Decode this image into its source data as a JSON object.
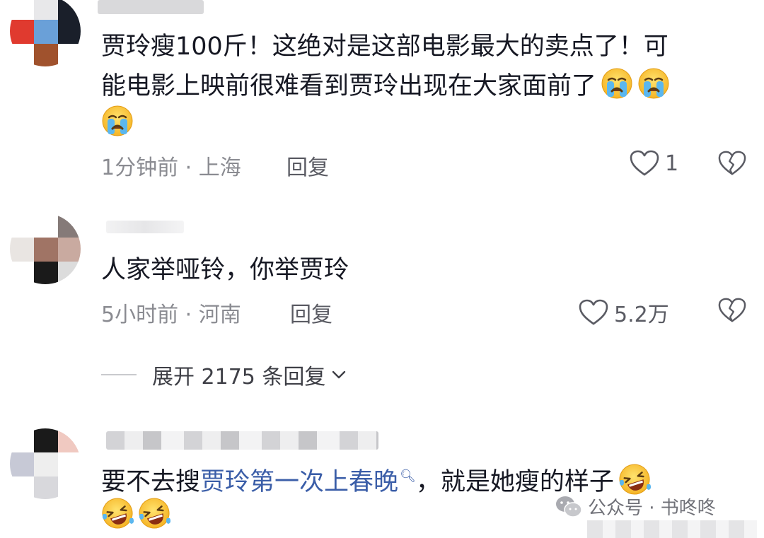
{
  "comments": [
    {
      "text_line1": "贾玲瘦100斤！这绝对是这部电影最大的卖点了！可",
      "text_line2": "能电影上映前很难看到贾玲出现在大家面前了",
      "emojis_line2": [
        "crying-emoji",
        "crying-emoji"
      ],
      "emojis_line3": [
        "crying-emoji"
      ],
      "time_location": "1分钟前 · 上海",
      "reply_label": "回复",
      "likes": "1",
      "avatar_colors": [
        "#ffffff",
        "#e8e8ea",
        "#1a1f2a",
        "#e03a2f",
        "#6aa0d8",
        "#1a1f2a",
        "#ffffff",
        "#a0522d",
        "#ffffff"
      ]
    },
    {
      "text": "人家举哑铃，你举贾玲",
      "time_location": "5小时前 · 河南",
      "reply_label": "回复",
      "likes": "5.2万",
      "avatar_colors": [
        "#ffffff",
        "#ffffff",
        "#857a78",
        "#e9e5e2",
        "#a07465",
        "#c9aaa0",
        "#ffffff",
        "#1a1a1a",
        "#dcdcdc"
      ]
    },
    {
      "text_prefix": "要不去搜",
      "text_link": "贾玲第一次上春晚",
      "text_suffix": "，就是她瘦的样子",
      "emojis_line1": [
        "laughing-crying-emoji"
      ],
      "emojis_line2": [
        "laughing-crying-emoji",
        "laughing-crying-emoji"
      ],
      "avatar_colors": [
        "#ffffff",
        "#1a1a1a",
        "#f0c9c1",
        "#c7c9d6",
        "#eeeeee",
        "#ffffff",
        "#ffffff",
        "#d8d8dc",
        "#ffffff"
      ]
    }
  ],
  "expand_replies": "展开 2175 条回复",
  "watermark": "公众号 · 书咚咚",
  "icons": {
    "like": "heart-outline-icon",
    "dislike": "broken-heart-icon",
    "expand": "chevron-down-icon",
    "search": "search-icon",
    "wechat": "wechat-logo-icon"
  },
  "colors": {
    "text": "#161823",
    "meta": "#8a8b91",
    "link": "#3b5ea8"
  }
}
